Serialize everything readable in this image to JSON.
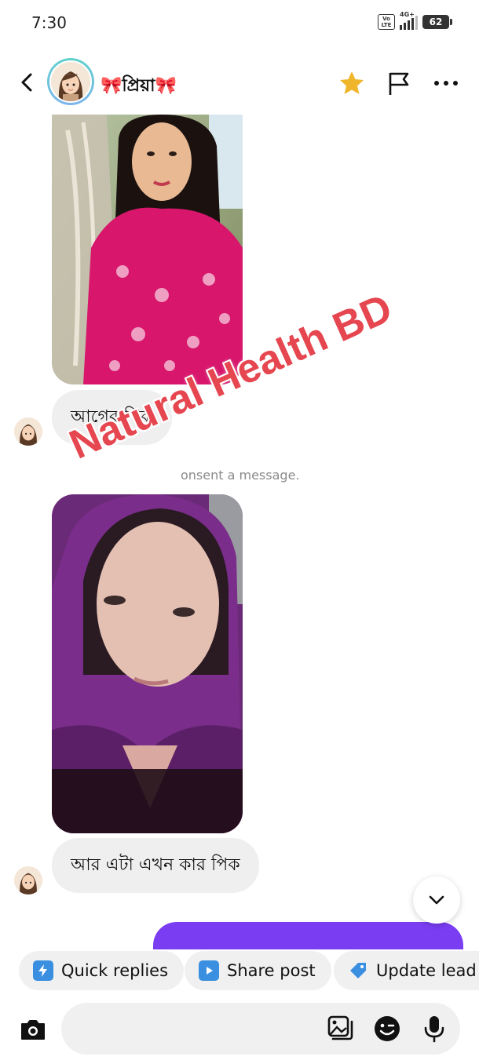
{
  "status_bar": {
    "time": "7:30",
    "volte": "Vo LTE",
    "network": "4G+",
    "battery": "62"
  },
  "header": {
    "contact_name": "🎀প্রিয়া🎀"
  },
  "messages": [
    {
      "type": "image",
      "description": "photo-1"
    },
    {
      "type": "text",
      "text": "আগের পিক"
    },
    {
      "type": "system",
      "text": "onsent a message."
    },
    {
      "type": "image",
      "description": "photo-2"
    },
    {
      "type": "text",
      "text": "আর এটা এখন কার পিক"
    }
  ],
  "watermark": "Natural Health BD",
  "quick_actions": [
    {
      "label": "Quick replies",
      "icon": "lightning-icon",
      "color": "#3b8fe0"
    },
    {
      "label": "Share post",
      "icon": "play-icon",
      "color": "#3b8fe0"
    },
    {
      "label": "Update lead s",
      "icon": "tag-icon",
      "color": "#3b8fe0"
    }
  ],
  "colors": {
    "accent_purple": "#7a3df2",
    "watermark_red": "#e6464f",
    "star_gold": "#f0b62b",
    "bubble_gray": "#efefef"
  }
}
